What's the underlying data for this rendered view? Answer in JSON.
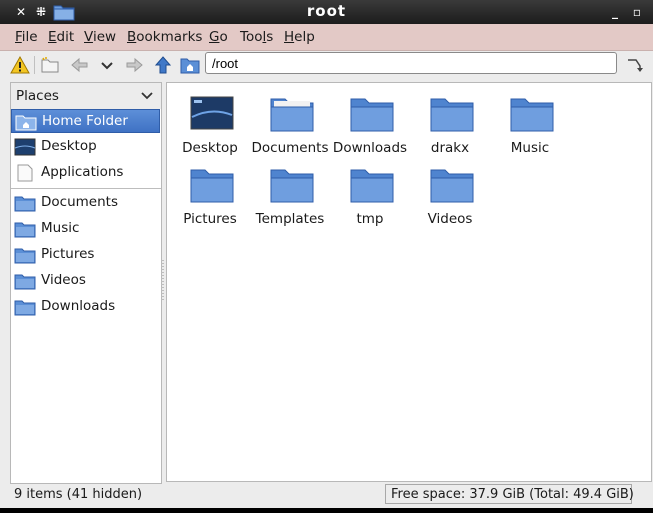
{
  "window": {
    "title": "root"
  },
  "menubar": [
    {
      "label": "File",
      "u": "F",
      "rest": "ile"
    },
    {
      "label": "Edit",
      "u": "E",
      "rest": "dit"
    },
    {
      "label": "View",
      "u": "V",
      "rest": "iew"
    },
    {
      "label": "Bookmarks",
      "u": "B",
      "rest": "ookmarks"
    },
    {
      "label": "Go",
      "u": "G",
      "rest": "o"
    },
    {
      "label": "Tools",
      "pre": "Too",
      "u": "l",
      "rest": "s"
    },
    {
      "label": "Help",
      "u": "H",
      "rest": "elp"
    }
  ],
  "location": {
    "value": "/root"
  },
  "sidebar": {
    "header": "Places",
    "items": [
      {
        "label": "Home Folder",
        "icon": "home-folder-icon",
        "selected": true
      },
      {
        "label": "Desktop",
        "icon": "desktop-icon"
      },
      {
        "label": "Applications",
        "icon": "applications-icon"
      },
      {
        "label": "Documents",
        "icon": "folder-icon"
      },
      {
        "label": "Music",
        "icon": "folder-icon"
      },
      {
        "label": "Pictures",
        "icon": "folder-icon"
      },
      {
        "label": "Videos",
        "icon": "folder-icon"
      },
      {
        "label": "Downloads",
        "icon": "folder-icon"
      }
    ]
  },
  "files": [
    {
      "label": "Desktop",
      "icon": "desktop-icon"
    },
    {
      "label": "Documents",
      "icon": "folder-icon"
    },
    {
      "label": "Downloads",
      "icon": "folder-icon"
    },
    {
      "label": "drakx",
      "icon": "folder-icon"
    },
    {
      "label": "Music",
      "icon": "folder-icon"
    },
    {
      "label": "Pictures",
      "icon": "folder-icon"
    },
    {
      "label": "Templates",
      "icon": "folder-icon"
    },
    {
      "label": "tmp",
      "icon": "folder-icon"
    },
    {
      "label": "Videos",
      "icon": "folder-icon"
    }
  ],
  "status": {
    "count": "9 items (41 hidden)",
    "free": "Free space: 37.9 GiB (Total: 49.4 GiB)"
  },
  "colors": {
    "selection": "#4a7fcf",
    "folder": "#5b8fd6",
    "menubar": "#e3c9c6"
  }
}
